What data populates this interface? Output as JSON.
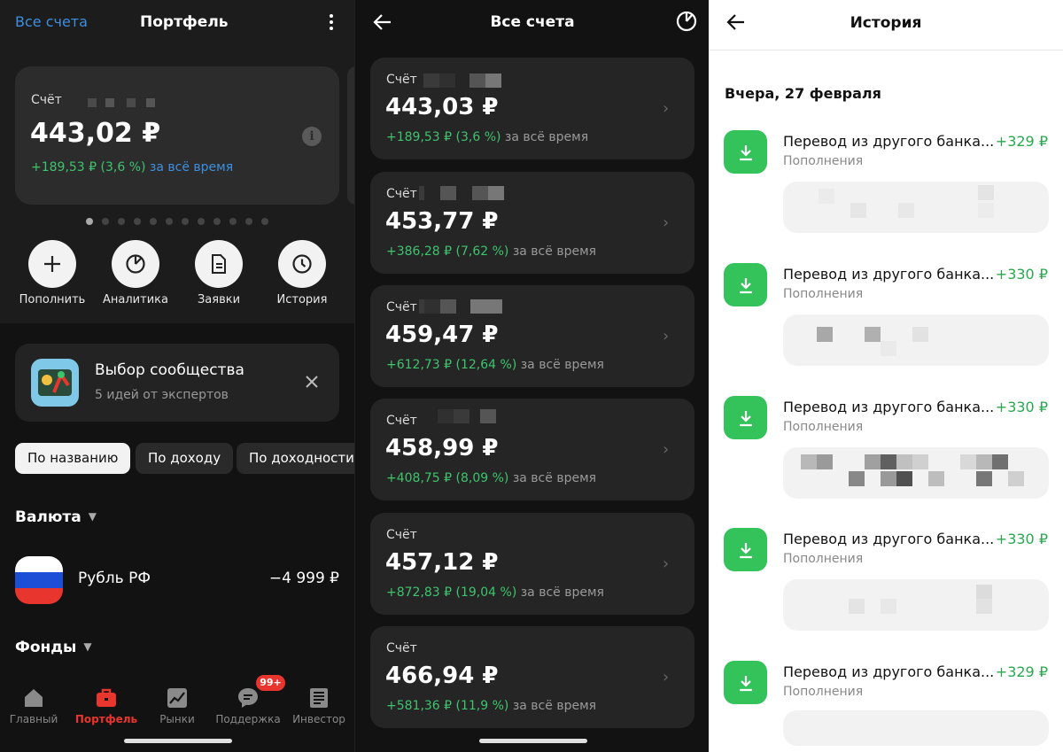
{
  "portfolio": {
    "back_link": "Все счета",
    "title": "Портфель",
    "card": {
      "label": "Счёт",
      "amount": "443,02 ₽",
      "change": "+189,53 ₽ (3,6 %)",
      "period": "за всё время"
    },
    "actions": [
      {
        "label": "Пополнить",
        "icon": "plus-icon"
      },
      {
        "label": "Аналитика",
        "icon": "analytics-icon"
      },
      {
        "label": "Заявки",
        "icon": "document-icon"
      },
      {
        "label": "История",
        "icon": "clock-icon"
      }
    ],
    "promo": {
      "title": "Выбор сообщества",
      "subtitle": "5 идей от экспертов"
    },
    "sort_chips": [
      "По названию",
      "По доходу",
      "По доходности"
    ],
    "currency_section": "Валюта",
    "currency": {
      "name": "Рубль РФ",
      "value": "−4 999 ₽"
    },
    "funds_section": "Фонды",
    "tabs": [
      {
        "label": "Главный",
        "icon": "home-icon"
      },
      {
        "label": "Портфель",
        "icon": "briefcase-icon"
      },
      {
        "label": "Рынки",
        "icon": "chart-icon"
      },
      {
        "label": "Поддержка",
        "icon": "chat-icon"
      },
      {
        "label": "Инвестор",
        "icon": "news-icon"
      }
    ],
    "support_badge": "99+",
    "colors": {
      "accent": "#e8352e",
      "positive": "#3ec46d",
      "link": "#3d8fe0"
    }
  },
  "accounts": {
    "title": "Все счета",
    "period": "за всё время",
    "items": [
      {
        "label": "Счёт",
        "amount": "443,03 ₽",
        "change": "+189,53 ₽ (3,6 %)"
      },
      {
        "label": "Счёт",
        "amount": "453,77 ₽",
        "change": "+386,28 ₽ (7,62 %)"
      },
      {
        "label": "Счёт",
        "amount": "459,47 ₽",
        "change": "+612,73 ₽ (12,64 %)"
      },
      {
        "label": "Счёт",
        "amount": "458,99 ₽",
        "change": "+408,75 ₽ (8,09 %)"
      },
      {
        "label": "Счёт",
        "amount": "457,12 ₽",
        "change": "+872,83 ₽ (19,04 %)"
      },
      {
        "label": "Счёт",
        "amount": "466,94 ₽",
        "change": "+581,36 ₽ (11,9 %)"
      }
    ]
  },
  "history": {
    "title": "История",
    "date_header": "Вчера, 27 февраля",
    "items": [
      {
        "name": "Перевод из другого банка...",
        "category": "Пополнения",
        "amount": "+329 ₽"
      },
      {
        "name": "Перевод из другого банка...",
        "category": "Пополнения",
        "amount": "+330 ₽"
      },
      {
        "name": "Перевод из другого банка...",
        "category": "Пополнения",
        "amount": "+330 ₽"
      },
      {
        "name": "Перевод из другого банка...",
        "category": "Пополнения",
        "amount": "+330 ₽"
      },
      {
        "name": "Перевод из другого банка...",
        "category": "Пополнения",
        "amount": "+329 ₽"
      }
    ]
  }
}
